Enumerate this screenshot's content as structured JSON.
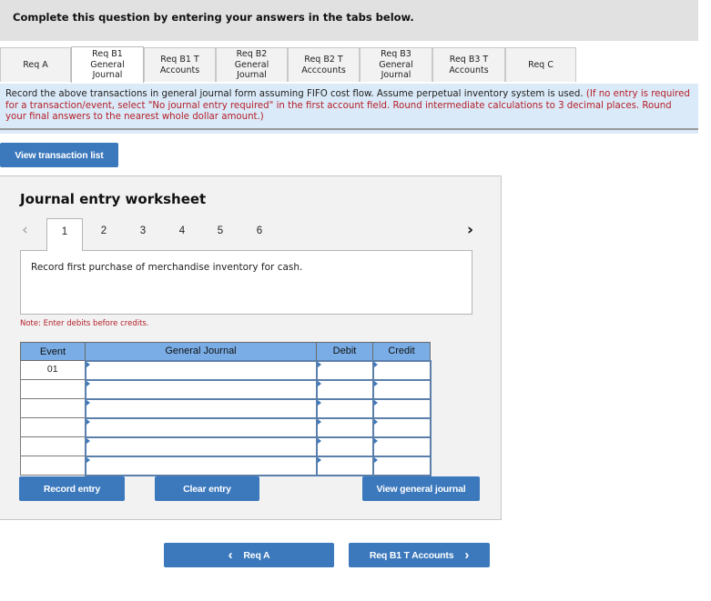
{
  "header": {
    "title": "Complete this question by entering your answers in the tabs below."
  },
  "tabs": [
    {
      "label": "Req A",
      "active": false
    },
    {
      "label": "Req B1\nGeneral\nJournal",
      "active": true
    },
    {
      "label": "Req B1 T\nAccounts",
      "active": false
    },
    {
      "label": "Req B2\nGeneral\nJournal",
      "active": false
    },
    {
      "label": "Req B2 T\nAcccounts",
      "active": false
    },
    {
      "label": "Req B3\nGeneral\nJournal",
      "active": false
    },
    {
      "label": "Req B3 T\nAccounts",
      "active": false
    },
    {
      "label": "Req C",
      "active": false
    }
  ],
  "instructions": {
    "main": "Record the above transactions in general journal form assuming FIFO cost flow. Assume perpetual inventory system is used.",
    "note": "(If no entry is required for a transaction/event, select \"No journal entry required\" in the first account field. Round intermediate calculations to 3 decimal places. Round your final answers to the nearest whole dollar amount.)"
  },
  "view_transaction_list_label": "View transaction list",
  "worksheet": {
    "title": "Journal entry worksheet",
    "prev_icon": "‹",
    "next_icon": "›",
    "steps": [
      "1",
      "2",
      "3",
      "4",
      "5",
      "6"
    ],
    "active_step": "1",
    "description": "Record first purchase of merchandise inventory for cash.",
    "note": "Note: Enter debits before credits.",
    "table": {
      "headers": {
        "event": "Event",
        "journal": "General Journal",
        "debit": "Debit",
        "credit": "Credit"
      },
      "rows": [
        {
          "event": "01",
          "account": "",
          "debit": "",
          "credit": ""
        },
        {
          "event": "",
          "account": "",
          "debit": "",
          "credit": ""
        },
        {
          "event": "",
          "account": "",
          "debit": "",
          "credit": ""
        },
        {
          "event": "",
          "account": "",
          "debit": "",
          "credit": ""
        },
        {
          "event": "",
          "account": "",
          "debit": "",
          "credit": ""
        },
        {
          "event": "",
          "account": "",
          "debit": "",
          "credit": ""
        }
      ]
    },
    "buttons": {
      "record": "Record entry",
      "clear": "Clear entry",
      "view_journal": "View general journal"
    }
  },
  "footer_nav": {
    "prev_label": "Req A",
    "prev_icon": "‹",
    "next_label": "Req B1 T Accounts",
    "next_icon": "›"
  },
  "colors": {
    "accent_blue": "#3b78bc",
    "table_header": "#7aade5",
    "instruction_bg": "#dbeaf8",
    "note_red": "#b4202a"
  }
}
